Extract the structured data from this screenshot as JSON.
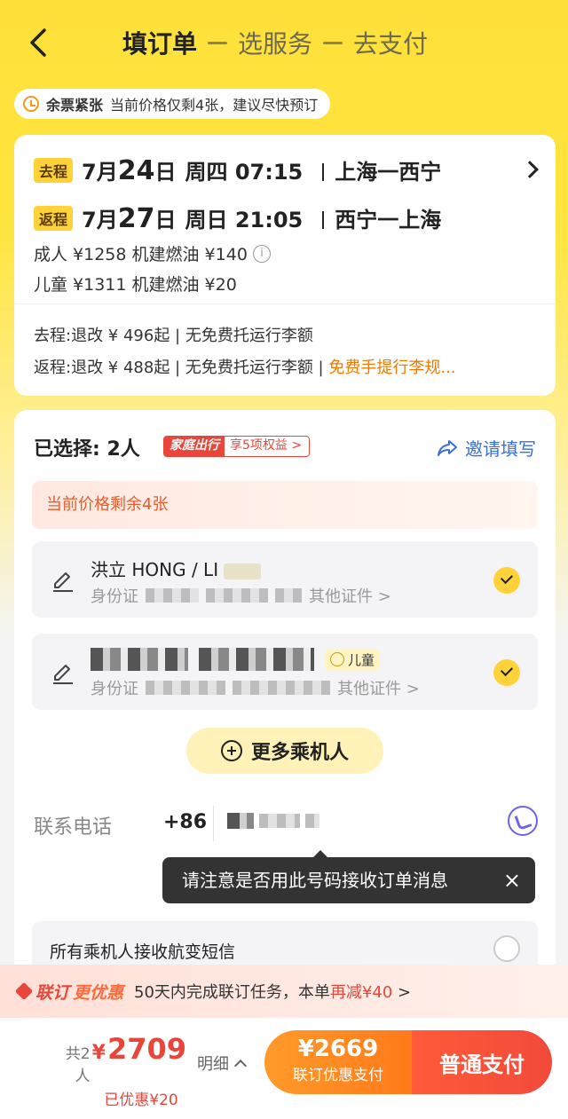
{
  "header": {
    "steps": [
      "填订单",
      "选服务",
      "去支付"
    ],
    "notice_strong": "余票紧张",
    "notice_text": "当前价格仅剩4张，建议尽快预订"
  },
  "flight": {
    "outbound": {
      "tag": "去程",
      "month": "7月",
      "day": "24",
      "day_suffix": "日",
      "weekday_time": "周四 07:15",
      "route": "上海一西宁"
    },
    "return": {
      "tag": "返程",
      "month": "7月",
      "day": "27",
      "day_suffix": "日",
      "weekday_time": "周日 21:05",
      "route": "西宁一上海"
    },
    "adult_price": "成人 ¥1258 机建燃油 ¥140",
    "child_price": "儿童 ¥1311 机建燃油 ¥20",
    "outbound_policy": "去程:退改 ¥ 496起 | 无免费托运行李额",
    "return_policy": "返程:退改 ¥ 488起 | 无免费托运行李额 |",
    "return_policy_link": "免费手提行李规..."
  },
  "passengers": {
    "selected_label": "已选择: 2人",
    "family_tag": "家庭出行",
    "family_benefit": "享5项权益 >",
    "invite_label": "邀请填写",
    "warning": "当前价格剩余4张",
    "list": [
      {
        "name": "洪立 HONG / LI",
        "id_type": "身份证",
        "other_id": "其他证件 >"
      },
      {
        "name": "",
        "id_type": "身份证",
        "child_tag": "儿童",
        "other_id": "其他证件 >"
      }
    ],
    "more_button": "更多乘机人"
  },
  "contact": {
    "label": "联系电话",
    "country_code": "+86",
    "tooltip": "请注意是否用此号码接收订单消息",
    "tooltip_close": "×",
    "sms_label": "所有乘机人接收航变短信"
  },
  "promo": {
    "logo_a": "联订",
    "logo_b": "更优惠",
    "text_a": "50天内完成联订任务，本单",
    "text_hl": "再减¥40",
    "text_tail": " >"
  },
  "bottom": {
    "count": "共2人",
    "currency": "¥",
    "total": "2709",
    "saved": "已优惠¥20",
    "detail": "明细",
    "joint_amount": "¥2669",
    "joint_label": "联订优惠支付",
    "normal_pay": "普通支付"
  }
}
